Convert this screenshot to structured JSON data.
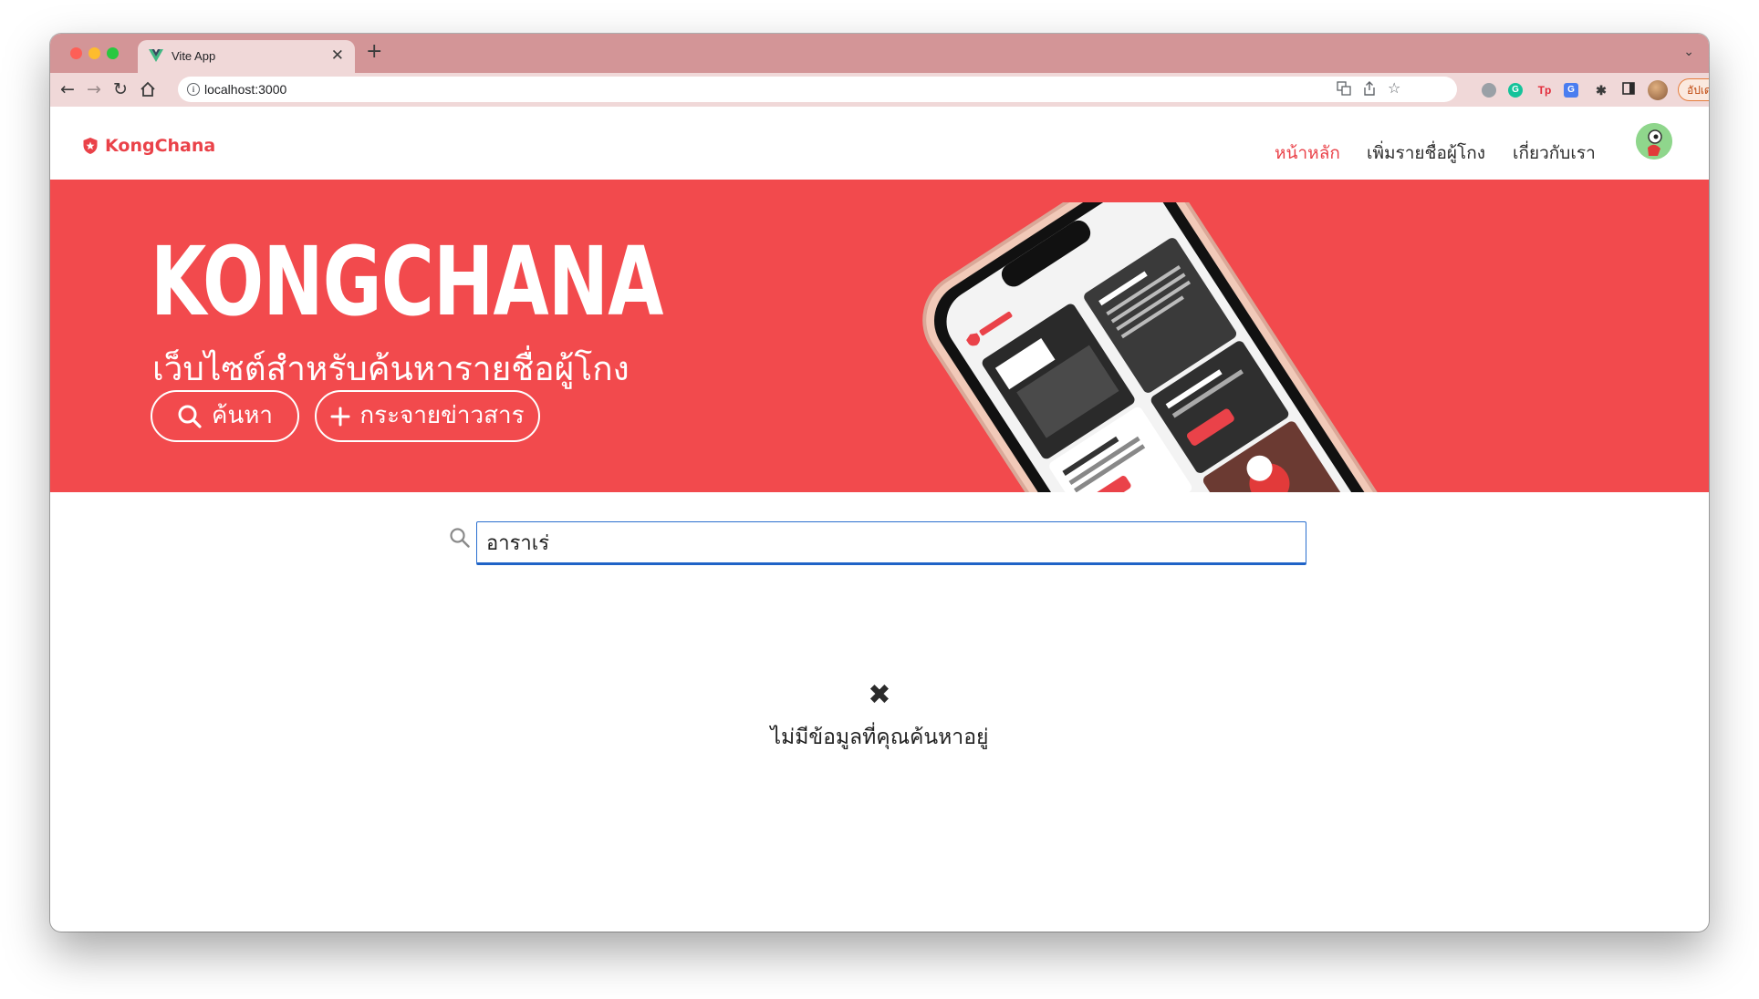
{
  "browser": {
    "tab_title": "Vite App",
    "tab_close": "✕",
    "new_tab": "+",
    "tab_menu": "⌄",
    "url": "localhost:3000",
    "update_label": "อัปเดต",
    "update_dots": "⋮"
  },
  "site": {
    "brand": "KongChana",
    "nav": {
      "home": "หน้าหลัก",
      "add": "เพิ่มรายชื่อผู้โกง",
      "about": "เกี่ยวกับเรา"
    },
    "hero": {
      "title": "KONGCHANA",
      "subtitle": "เว็บไซต์สำหรับค้นหารายชื่อผู้โกง",
      "search_button": "ค้นหา",
      "spread_button": "กระจายข่าวสาร"
    },
    "search": {
      "value": "อาราเร่"
    },
    "empty_state": {
      "icon": "✖",
      "message": "ไม่มีข้อมูลที่คุณค้นหาอยู่"
    }
  },
  "colors": {
    "brand_red": "#f24a4d",
    "accent_red": "#ea4249",
    "tab_strip": "#d39597",
    "toolbar": "#f0d8d8",
    "input_focus": "#2a6fcf"
  }
}
